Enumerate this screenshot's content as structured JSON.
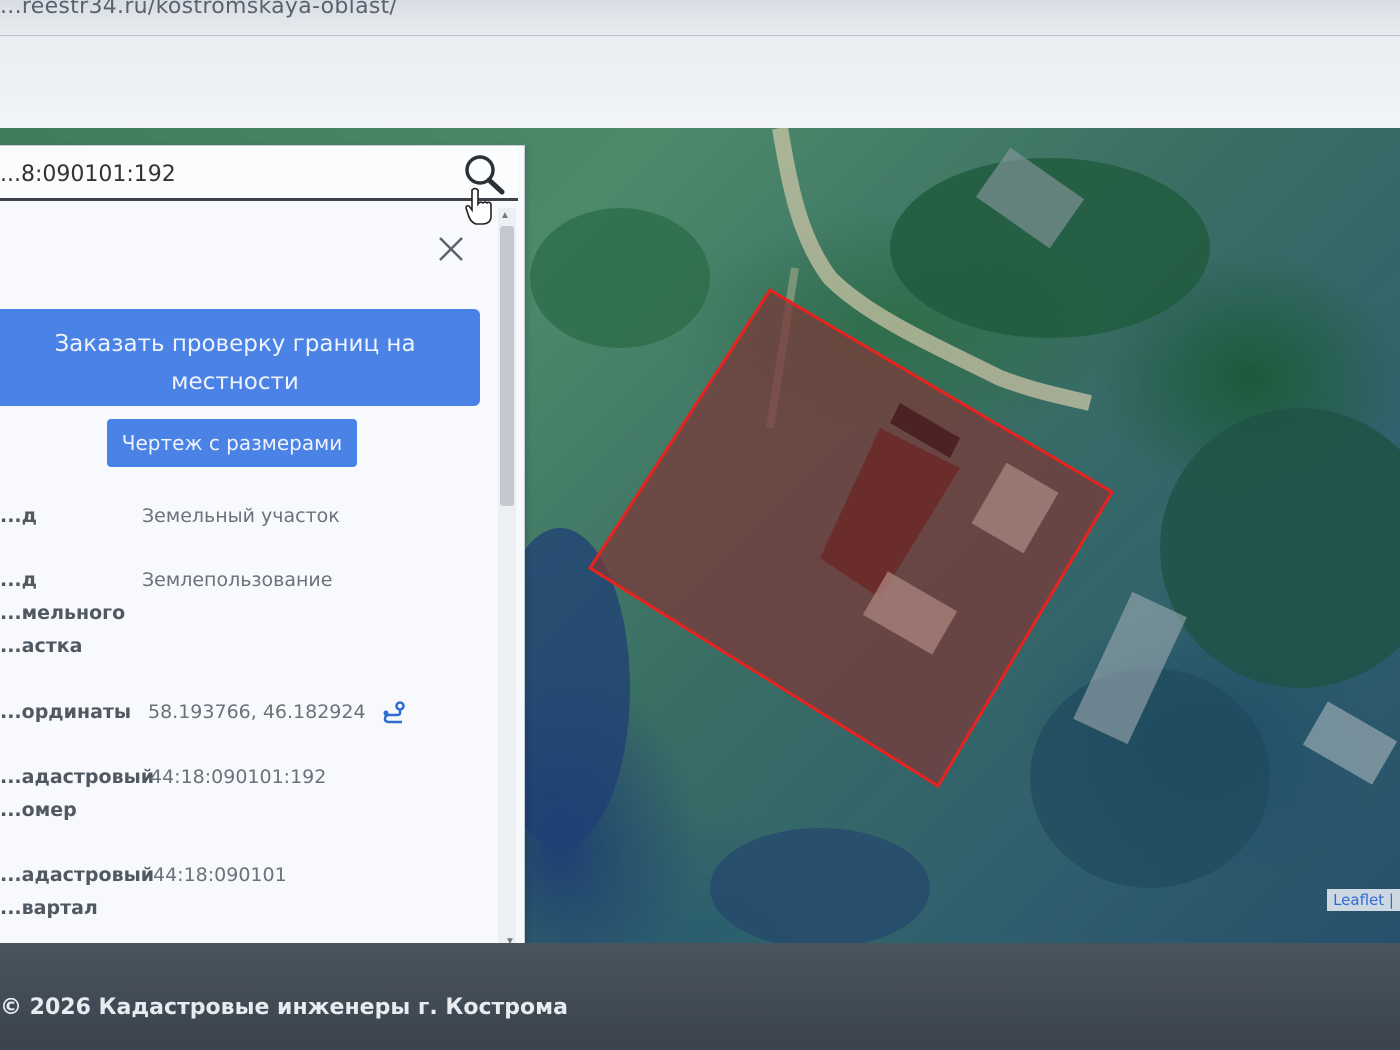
{
  "browser": {
    "url": "...reestr34.ru/kostromskaya-oblast/"
  },
  "search": {
    "value": "...8:090101:192"
  },
  "panel": {
    "order_button": "Заказать проверку границ на местности",
    "drawing_button": "Чертеж с размерами",
    "properties": [
      {
        "label": "...д",
        "value": "Земельный участок"
      },
      {
        "label": "...д ...мельного ...астка",
        "value": "Землепользование"
      },
      {
        "label": "...ординаты",
        "value": "58.193766, 46.182924"
      },
      {
        "label": "...адастровый ...омер",
        "value": "44:18:090101:192"
      },
      {
        "label": "...адастровый ...вартал",
        "value": "44:18:090101"
      }
    ]
  },
  "map": {
    "attribution": "Leaflet |",
    "parcel_outline_color": "#e8231f"
  },
  "footer": {
    "copyright": "© 2026 Кадастровые инженеры г. Кострома"
  },
  "icons": {
    "search": "search-icon",
    "close": "close-icon",
    "route": "route-icon"
  }
}
